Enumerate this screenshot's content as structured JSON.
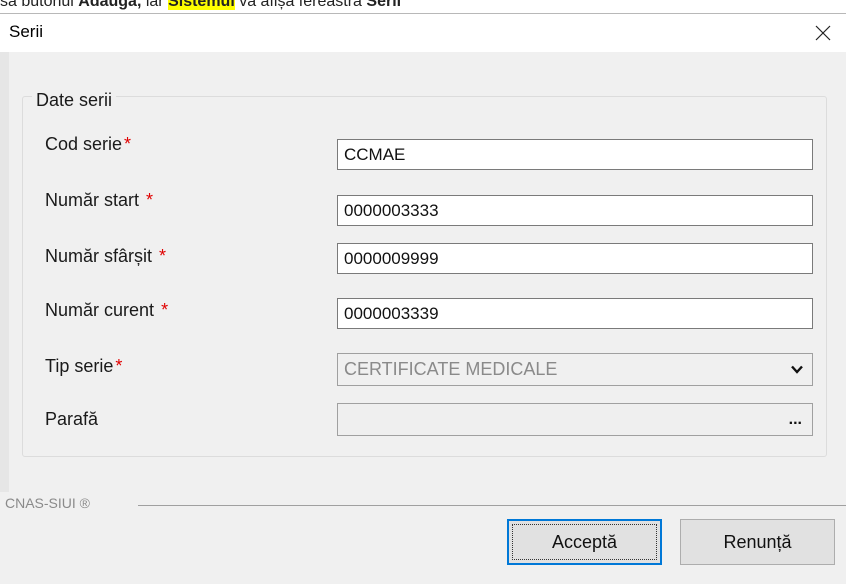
{
  "doc_line": {
    "prefix": "să butonul ",
    "bold1": "Adaugă,",
    "mid": " iar ",
    "highlight": "Sistemul",
    "suffix": " va afișa fereastra ",
    "bold2": "Serii"
  },
  "window": {
    "title": "Serii"
  },
  "group": {
    "legend": "Date serii"
  },
  "fields": {
    "cod_serie": {
      "label": "Cod serie",
      "required": "*",
      "value": "CCMAE"
    },
    "numar_start": {
      "label": "Număr start",
      "required": "*",
      "value": "0000003333"
    },
    "numar_sfarsit": {
      "label": "Număr sfârșit",
      "required": "*",
      "value": "0000009999"
    },
    "numar_curent": {
      "label": "Număr curent",
      "required": "*",
      "value": "0000003339"
    },
    "tip_serie": {
      "label": "Tip serie",
      "required": "*",
      "value": "CERTIFICATE MEDICALE"
    },
    "parafa": {
      "label": "Parafă",
      "value": "",
      "button": "..."
    }
  },
  "footer": {
    "brand": "CNAS-SIUI ®"
  },
  "buttons": {
    "accept": "Acceptă",
    "cancel": "Renunță"
  },
  "colors": {
    "required": "#e00000",
    "focus_border": "#0078d7",
    "highlight": "#ffff00"
  },
  "icons": {
    "close": "close-icon",
    "dropdown": "chevron-down-icon"
  }
}
